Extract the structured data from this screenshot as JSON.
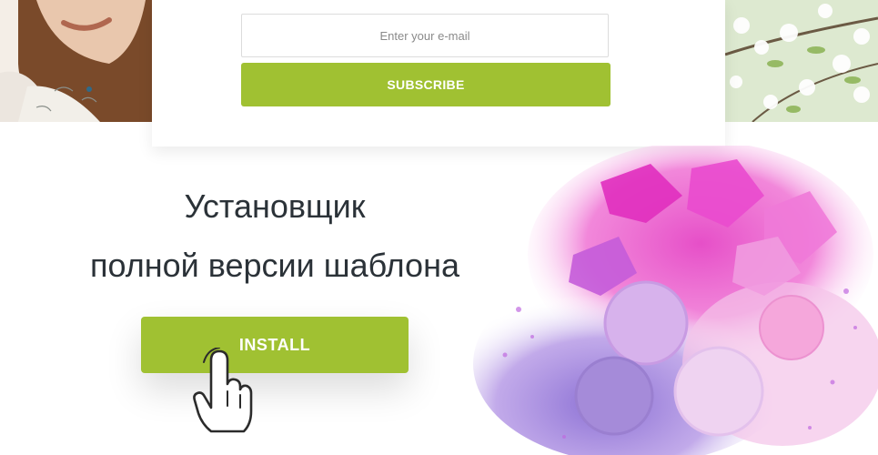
{
  "subscribe": {
    "email_placeholder": "Enter your e-mail",
    "button_label": "SUBSCRIBE"
  },
  "installer": {
    "headline_line1": "Установщик",
    "headline_line2": "полной версии шаблона",
    "install_label": "INSTALL"
  },
  "colors": {
    "accent_green": "#a0c132",
    "heading_text": "#2b3238"
  },
  "icons": {
    "pointer": "hand-pointer-icon"
  }
}
